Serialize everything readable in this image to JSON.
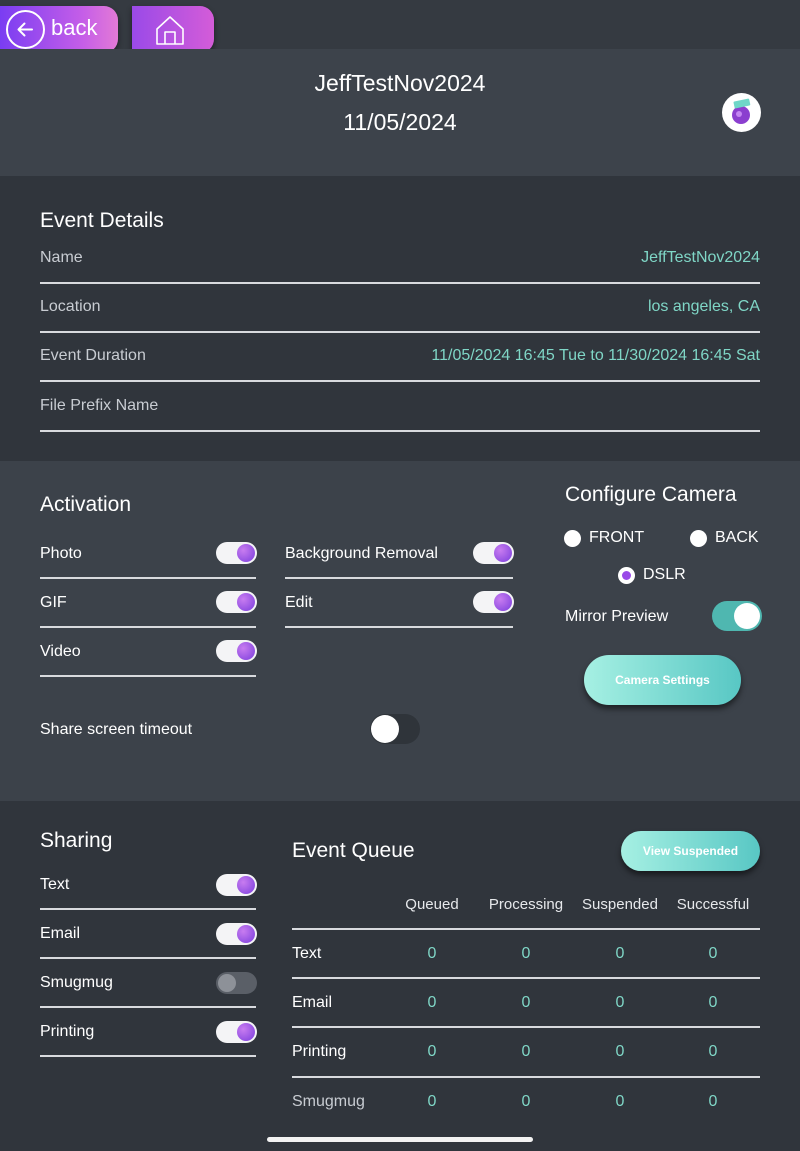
{
  "nav": {
    "back_label": "back"
  },
  "header": {
    "title": "JeffTestNov2024",
    "date": "11/05/2024"
  },
  "event_details": {
    "title": "Event Details",
    "rows": [
      {
        "label": "Name",
        "value": "JeffTestNov2024"
      },
      {
        "label": "Location",
        "value": "los angeles, CA"
      },
      {
        "label": "Event Duration",
        "value": "11/05/2024 16:45 Tue to 11/30/2024 16:45 Sat"
      },
      {
        "label": "File Prefix Name",
        "value": ""
      }
    ]
  },
  "activation": {
    "title": "Activation",
    "left": [
      {
        "label": "Photo",
        "on": true
      },
      {
        "label": "GIF",
        "on": true
      },
      {
        "label": "Video",
        "on": true
      }
    ],
    "right": [
      {
        "label": "Background Removal",
        "on": true
      },
      {
        "label": "Edit",
        "on": true
      }
    ],
    "share_timeout": {
      "label": "Share screen timeout",
      "on": false
    }
  },
  "camera": {
    "title": "Configure Camera",
    "options": [
      {
        "label": "FRONT",
        "selected": false
      },
      {
        "label": "BACK",
        "selected": false
      },
      {
        "label": "DSLR",
        "selected": true
      }
    ],
    "mirror_label": "Mirror Preview",
    "mirror_on": true,
    "settings_button": "Camera Settings"
  },
  "sharing": {
    "title": "Sharing",
    "items": [
      {
        "label": "Text",
        "on": true
      },
      {
        "label": "Email",
        "on": true
      },
      {
        "label": "Smugmug",
        "on": false
      },
      {
        "label": "Printing",
        "on": true
      }
    ]
  },
  "queue": {
    "title": "Event Queue",
    "view_suspended_button": "View Suspended",
    "columns": [
      "Queued",
      "Processing",
      "Suspended",
      "Successful"
    ],
    "rows": [
      {
        "label": "Text",
        "values": [
          "0",
          "0",
          "0",
          "0"
        ]
      },
      {
        "label": "Email",
        "values": [
          "0",
          "0",
          "0",
          "0"
        ]
      },
      {
        "label": "Printing",
        "values": [
          "0",
          "0",
          "0",
          "0"
        ]
      },
      {
        "label": "Smugmug",
        "values": [
          "0",
          "0",
          "0",
          "0"
        ]
      }
    ]
  },
  "colors": {
    "accent_purple": "#9a4ae8",
    "accent_teal": "#7fd6c6",
    "background": "#353a41"
  }
}
